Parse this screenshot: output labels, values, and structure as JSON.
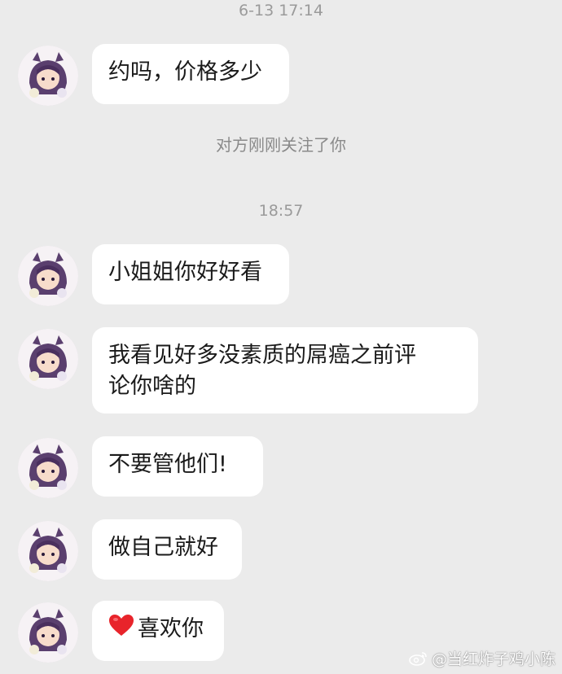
{
  "timestamps": [
    "6-13 17:14",
    "18:57"
  ],
  "system_notice": "对方刚刚关注了你",
  "messages": [
    {
      "text": "约吗，价格多少"
    },
    {
      "text": "小姐姐你好好看"
    },
    {
      "text_line1": "我看见好多没素质的屌癌之前评",
      "text_line2": "论你啥的"
    },
    {
      "text": "不要管他们!"
    },
    {
      "text": "做自己就好"
    },
    {
      "text": "喜欢你",
      "icon": "heart-icon"
    }
  ],
  "watermark": "@当红炸子鸡小陈",
  "avatar_icon": "anime-avatar-icon",
  "colors": {
    "background": "#ebebeb",
    "bubble": "#ffffff",
    "heart": "#e8242b"
  }
}
